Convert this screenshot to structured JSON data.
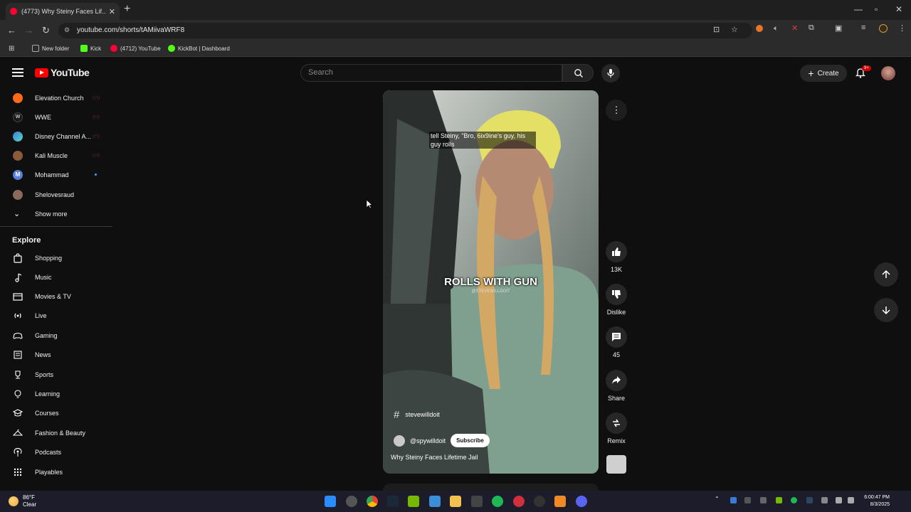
{
  "browser": {
    "tab_title": "(4773) Why Steiny Faces Lif...",
    "url": "youtube.com/shorts/tAMiivaWRF8",
    "bookmarks": [
      {
        "label": "New folder",
        "color": "#aaaaaa"
      },
      {
        "label": "Kick",
        "color": "#53fc18"
      },
      {
        "label": "(4712) YouTube",
        "color": "#ff0033"
      },
      {
        "label": "KickBot | Dashboard",
        "color": "#53fc18"
      }
    ]
  },
  "header": {
    "logo_text": "YouTube",
    "search_placeholder": "Search",
    "create_label": "Create",
    "notification_badge": "9+"
  },
  "sidebar": {
    "subscriptions": [
      {
        "label": "Elevation Church",
        "color": "#ff6a1a",
        "live": "((•))"
      },
      {
        "label": "WWE",
        "color": "#1a1a1a",
        "live": "((•))"
      },
      {
        "label": "Disney Channel A...",
        "color": "#3a7bd5",
        "live": "((•))"
      },
      {
        "label": "Kali Muscle",
        "color": "#8a5a3a",
        "live": "((•))"
      },
      {
        "label": "Mohammad",
        "color": "#5a7fd6",
        "live": ""
      },
      {
        "label": "Shelovesraud",
        "color": "#8a6a5a",
        "live": ""
      }
    ],
    "show_more": "Show more",
    "explore_title": "Explore",
    "explore": [
      {
        "label": "Shopping",
        "icon": "shopping-bag-icon"
      },
      {
        "label": "Music",
        "icon": "music-note-icon"
      },
      {
        "label": "Movies & TV",
        "icon": "film-icon"
      },
      {
        "label": "Live",
        "icon": "live-icon"
      },
      {
        "label": "Gaming",
        "icon": "gamepad-icon"
      },
      {
        "label": "News",
        "icon": "newspaper-icon"
      },
      {
        "label": "Sports",
        "icon": "trophy-icon"
      },
      {
        "label": "Learning",
        "icon": "lightbulb-icon"
      },
      {
        "label": "Courses",
        "icon": "graduation-cap-icon"
      },
      {
        "label": "Fashion & Beauty",
        "icon": "hanger-icon"
      },
      {
        "label": "Podcasts",
        "icon": "podcast-icon"
      },
      {
        "label": "Playables",
        "icon": "playables-icon"
      }
    ]
  },
  "short": {
    "caption_top": "tell Steiny, \"Bro, 6ix9ine's guy, his guy rolls",
    "caption_main": "ROLLS WITH GUN",
    "watermark": "@STEVEWILLDOIT",
    "hashtag": "stevewilldoit",
    "channel": "@spywilldoit",
    "subscribe_label": "Subscribe",
    "title": "Why Steiny Faces Lifetime Jail"
  },
  "actions": {
    "like_count": "13K",
    "dislike_label": "Dislike",
    "comment_count": "45",
    "share_label": "Share",
    "remix_label": "Remix"
  },
  "taskbar": {
    "temperature": "86°F",
    "condition": "Clear",
    "time": "6:00:47 PM",
    "date": "8/3/2025"
  }
}
